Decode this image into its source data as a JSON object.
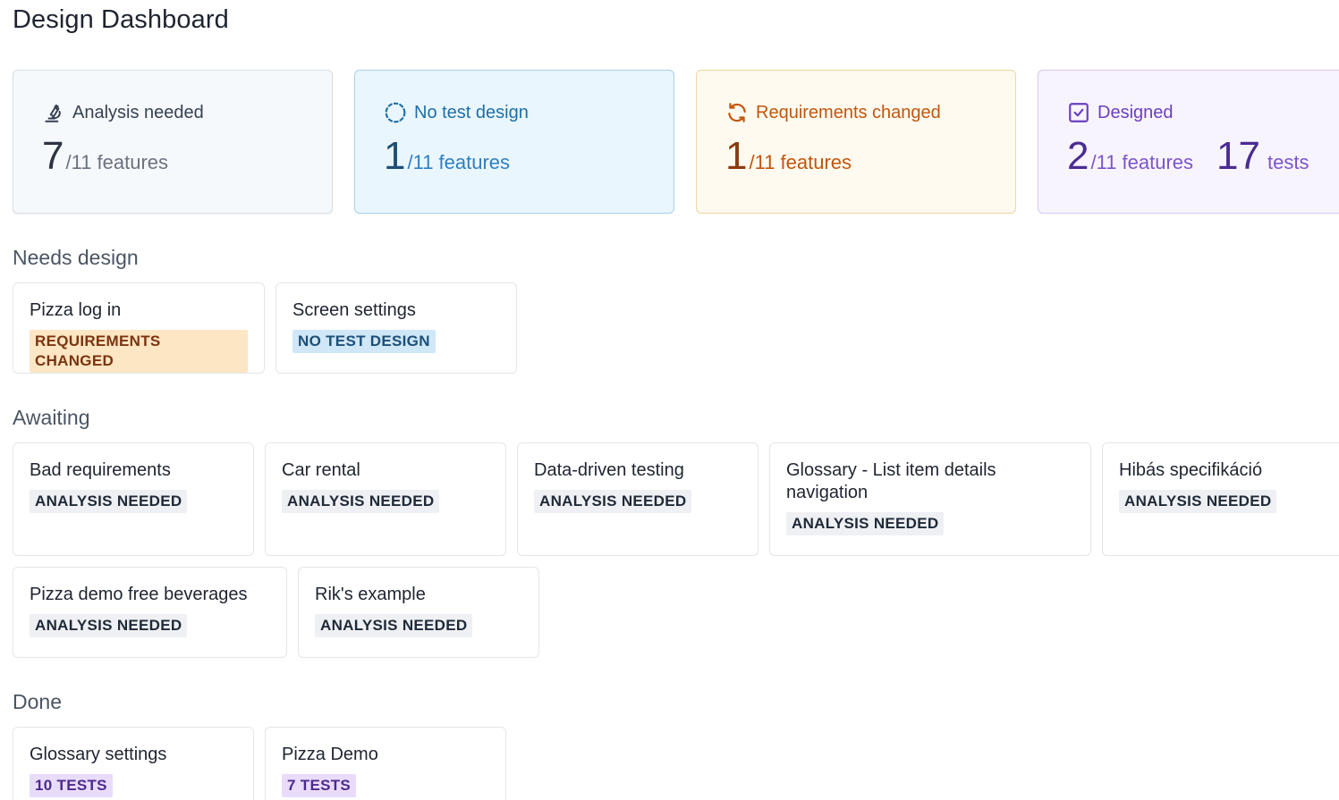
{
  "page": {
    "title": "Design Dashboard"
  },
  "stats": [
    {
      "key": "analysis",
      "label": "Analysis needed",
      "icon": "microscope-icon",
      "count": "7",
      "total": "/11 features"
    },
    {
      "key": "notest",
      "label": "No test design",
      "icon": "dashed-circle-icon",
      "count": "1",
      "total": "/11 features"
    },
    {
      "key": "changed",
      "label": "Requirements changed",
      "icon": "refresh-icon",
      "count": "1",
      "total": "/11 features"
    },
    {
      "key": "designed",
      "label": "Designed",
      "icon": "checkbox-icon",
      "count": "2",
      "total": "/11 features",
      "tests_count": "17",
      "tests_label": "tests"
    }
  ],
  "sections": {
    "needs_design": {
      "title": "Needs design",
      "items": [
        {
          "name": "Pizza log in",
          "badge": "REQUIREMENTS CHANGED"
        },
        {
          "name": "Screen settings",
          "badge": "NO TEST DESIGN"
        }
      ]
    },
    "awaiting": {
      "title": "Awaiting",
      "items": [
        {
          "name": "Bad requirements",
          "badge": "ANALYSIS NEEDED"
        },
        {
          "name": "Car rental",
          "badge": "ANALYSIS NEEDED"
        },
        {
          "name": "Data-driven testing",
          "badge": "ANALYSIS NEEDED"
        },
        {
          "name": "Glossary - List item details navigation",
          "badge": "ANALYSIS NEEDED"
        },
        {
          "name": "Hibás specifikáció",
          "badge": "ANALYSIS NEEDED"
        },
        {
          "name": "Pizza demo free beverages",
          "badge": "ANALYSIS NEEDED"
        },
        {
          "name": "Rik's example",
          "badge": "ANALYSIS NEEDED"
        }
      ]
    },
    "done": {
      "title": "Done",
      "items": [
        {
          "name": "Glossary settings",
          "badge": "10 TESTS"
        },
        {
          "name": "Pizza Demo",
          "badge": "7 TESTS"
        }
      ]
    }
  },
  "colors": {
    "analysis": "#374151",
    "no_test": "#1d6fa8",
    "changed": "#c2560b",
    "designed": "#6b3fbf"
  }
}
